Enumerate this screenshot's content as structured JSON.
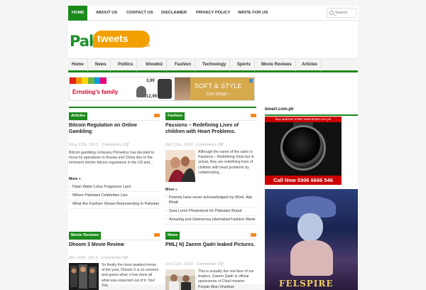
{
  "topnav": {
    "items": [
      "HOME",
      "ABOUT US",
      "CONTACT US",
      "DISCLAIMER",
      "PRIVACY POLICY",
      "WRITE FOR US"
    ],
    "active": "HOME",
    "search_placeholder": "Search"
  },
  "logo": {
    "pak": "Pak",
    "tweets": "tweets",
    "com": ".COM"
  },
  "mainmenu": {
    "items": [
      "Home",
      "News",
      "Politics",
      "Showbiz",
      "Fashion",
      "Technology",
      "Sports",
      "Movie Reviews",
      "Articles"
    ]
  },
  "banner": {
    "brand": "Ernsting's family",
    "price1": "3,99",
    "price2": "12,99",
    "headline": "SOFT & STYLE",
    "cta": "Zum Shop! ›",
    "stripe_colors": [
      "#e2231a",
      "#f39200",
      "#ffd500",
      "#6cb33f",
      "#009fe3",
      "#e5007d"
    ]
  },
  "blocks": [
    {
      "category": "Articles",
      "title": "Bitcoin Regulation on Online Gambling",
      "meta": "May 15th, 2015 · Comments Off",
      "excerpt": "Bitcoin gambling company Primedice has decided to move its operations to Russia and China due to the imminent stricter bitcoin regulations in the US and...",
      "more": "More »",
      "related": [
        "Fijian Water Lotus Fragrance Laun",
        "Where Pakistani Celebrities Live",
        "What Are Fashion Shows Representing In Pakistan"
      ]
    },
    {
      "category": "Fashion",
      "title": "Passions – Redefining Lives of children with Heart Problems.",
      "meta": "Oct 21st, 2014 · Comments Off",
      "excerpt": "Although the name of the salon is Passions – Redefining Style but in actual, they are redefining lives of children with heart problems by collaborating...",
      "more": "More »",
      "related": [
        "Parents have never acknowledged my Work. Alia Bhatt.",
        "Sara Loren Photoshoot for Pakistani Brand",
        "Amazing and Glamorous Islamabad Fashion Week"
      ]
    },
    {
      "category": "Movie Reviews",
      "title": "Dhoom 3 Movie Review",
      "meta": "Dec 20th, 2013 · Comments Off",
      "excerpt": "So finally the most awaited movie of the year, Dhoom 3 is on screens and guess what, it has done all what was expected out of it. Yes! The"
    },
    {
      "category": "News",
      "title": "PML( N) Zaeem Qadri leaked Pictures.",
      "meta": "Oct 21st, 2014 · Comments Off",
      "excerpt": "This is actually the real face of our leaders. Zaeem Qadri is official spokesman of Chief minister Punjab Mian Shahbaz"
    }
  ],
  "sidebar": {
    "title": "bmart.com.pk",
    "watch_top": "Buy watches online www.bmart.com.pk",
    "watch_call": "Call Now 0306 6666 546",
    "game_logo": "FELSPIRE"
  },
  "colors": {
    "accent": "#1a8a1a",
    "logo_orange": "#f2a000",
    "rss": "#f08a24"
  }
}
